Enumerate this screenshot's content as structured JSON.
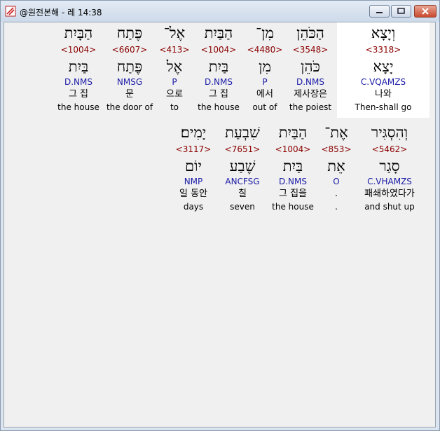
{
  "window": {
    "title": "@원전본해 - 레 14:38"
  },
  "rows": [
    {
      "words": [
        {
          "surface": "וְיָצָא",
          "strong": "<3318>",
          "lemma": "יָצָא",
          "parse": "C.VQAMZS",
          "korean": "나와",
          "english": "Then-shall go",
          "selected": true
        },
        {
          "surface": "הַכֹּהֵן",
          "strong": "<3548>",
          "lemma": "כֹּהֵן",
          "parse": "D.NMS",
          "korean": "제사장은",
          "english": "the poiest"
        },
        {
          "surface": "מִן־",
          "strong": "<4480>",
          "lemma": "מִן",
          "parse": "P",
          "korean": "에서",
          "english": "out of"
        },
        {
          "surface": "הַבַּיִת",
          "strong": "<1004>",
          "lemma": "בַּיִת",
          "parse": "D.NMS",
          "korean": "그 집",
          "english": "the house"
        },
        {
          "surface": "אֶל־",
          "strong": "<413>",
          "lemma": "אֶל",
          "parse": "P",
          "korean": "으로",
          "english": "to"
        },
        {
          "surface": "פֶּתַח",
          "strong": "<6607>",
          "lemma": "פֶּתַח",
          "parse": "NMSG",
          "korean": "문",
          "english": "the door of"
        },
        {
          "surface": "הַבָּיִת",
          "strong": "<1004>",
          "lemma": "בַּיִת",
          "parse": "D.NMS",
          "korean": "그 집",
          "english": "the house"
        }
      ]
    },
    {
      "words": [
        {
          "surface": "וְהִסְגִּיר",
          "strong": "<5462>",
          "lemma": "סָגַר",
          "parse": "C.VHAMZS",
          "korean": "패쇄하였다가",
          "english": "and shut up"
        },
        {
          "surface": "אֶת־",
          "strong": "<853>",
          "lemma": "אֵת",
          "parse": "O",
          "korean": ".",
          "english": "."
        },
        {
          "surface": "הַבַּיִת",
          "strong": "<1004>",
          "lemma": "בַּיִת",
          "parse": "D.NMS",
          "korean": "그 집을",
          "english": "the house"
        },
        {
          "surface": "שִׁבְעַת",
          "strong": "<7651>",
          "lemma": "שֶׁבַע",
          "parse": "ANCFSG",
          "korean": "칠",
          "english": "seven"
        },
        {
          "surface": "יָמִים׃",
          "strong": "<3117>",
          "lemma": "יוֹם",
          "parse": "NMP",
          "korean": "일 동안",
          "english": "days"
        }
      ]
    }
  ]
}
